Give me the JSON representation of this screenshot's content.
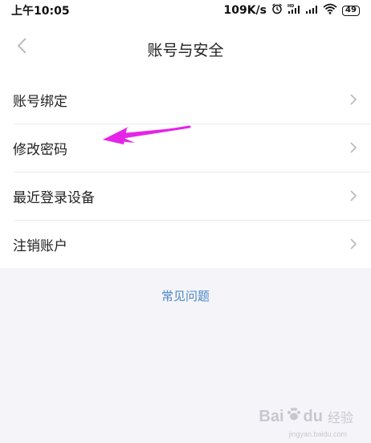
{
  "status_bar": {
    "time": "上午10:05",
    "network_speed": "109K/s",
    "battery_level": "49"
  },
  "nav": {
    "title": "账号与安全"
  },
  "menu_items": [
    {
      "label": "账号绑定"
    },
    {
      "label": "修改密码"
    },
    {
      "label": "最近登录设备"
    },
    {
      "label": "注销账户"
    }
  ],
  "faq": {
    "label": "常见问题"
  },
  "watermark": {
    "brand": "Bai",
    "suffix": "du",
    "sub": "经验",
    "url": "jingyan.baidu.com"
  },
  "colors": {
    "accent_link": "#4a86c8",
    "annotation_arrow": "#e524e8",
    "background": "#f5f5f9"
  }
}
